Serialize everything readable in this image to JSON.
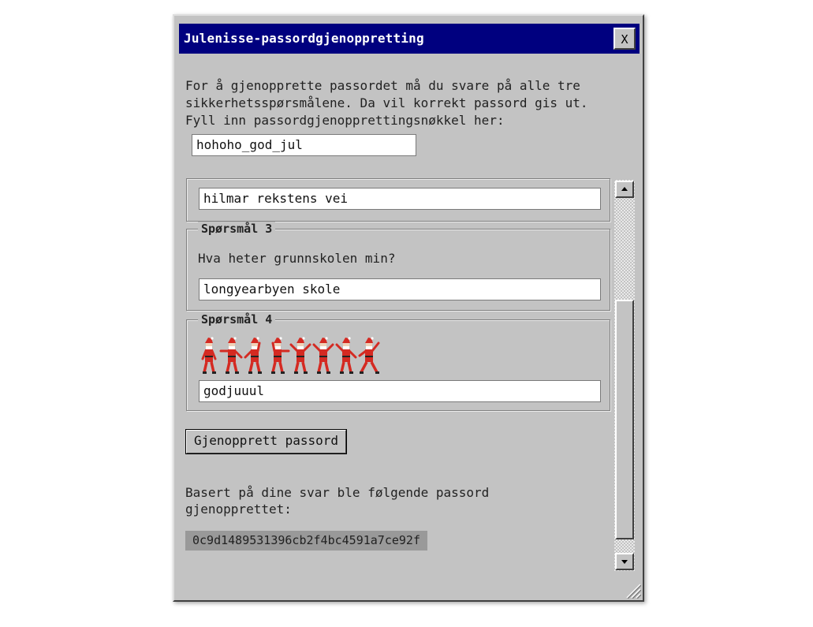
{
  "window": {
    "title": "Julenisse-passordgjenoppretting",
    "close_label": "X"
  },
  "intro": {
    "text": "For å gjenopprette passordet må du svare på alle tre\nsikkerhetsspørsmålene. Da vil korrekt passord gis ut.\nFyll inn passordgjenopprettingsnøkkel her:",
    "key_value": "hohoho_god_jul"
  },
  "questions": [
    {
      "answer": "hilmar rekstens vei"
    },
    {
      "legend": "Spørsmål 3",
      "question": "Hva heter grunnskolen min?",
      "answer": "longyearbyen skole"
    },
    {
      "legend": "Spørsmål 4",
      "answer": "godjuuul"
    }
  ],
  "semaphore": {
    "figure_count": 8,
    "colors": {
      "suit": "#d42a22",
      "face": "#f0d2b8",
      "beard": "#ffffff",
      "boots": "#222222"
    }
  },
  "submit_button": "Gjenopprett passord",
  "result": {
    "text": "Basert på dine svar ble følgende passord\ngjenopprettet:",
    "password": "0c9d1489531396cb2f4bc4591a7ce92f"
  },
  "colors": {
    "titlebar": "#00007f",
    "window_bg": "#c3c3c3",
    "hash_bg": "#999999"
  }
}
